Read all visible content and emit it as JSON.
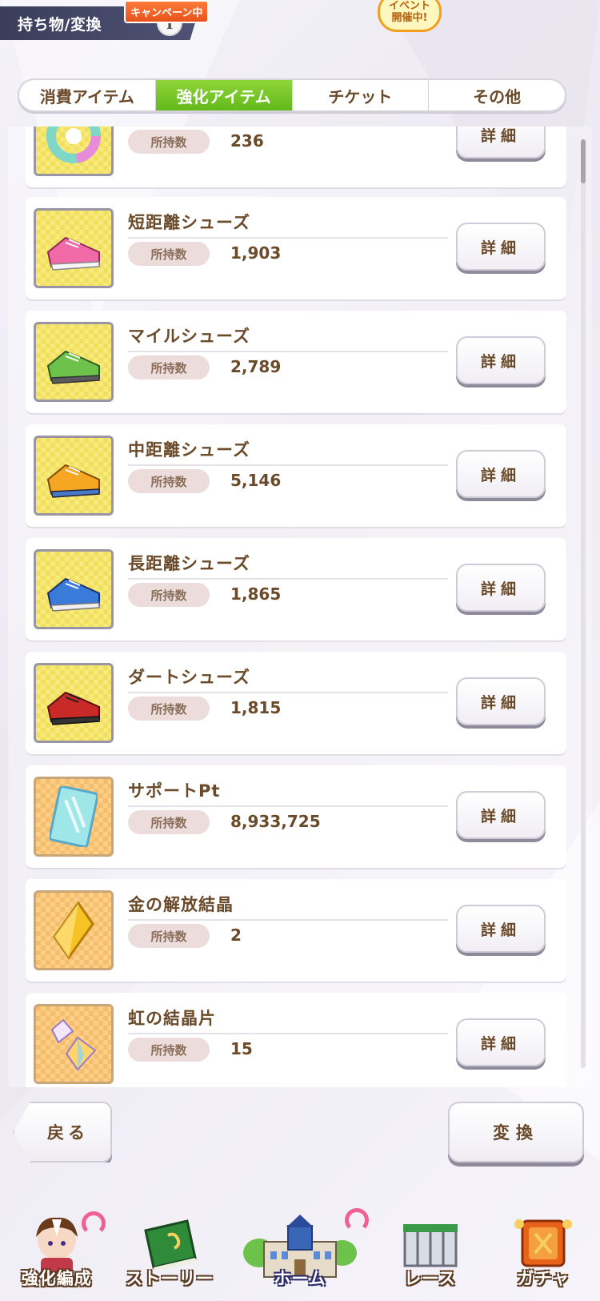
{
  "header": {
    "title": "持ち物/変換",
    "info_icon": "info-icon",
    "info_glyph": "i"
  },
  "tabs": [
    {
      "label": "消費アイテム",
      "active": false
    },
    {
      "label": "強化アイテム",
      "active": true
    },
    {
      "label": "チケット",
      "active": false
    },
    {
      "label": "その他",
      "active": false
    }
  ],
  "items": [
    {
      "name": "",
      "qty_label": "所持数",
      "qty": "236",
      "detail_label": "詳細",
      "icon": "rainbow-disc-icon"
    },
    {
      "name": "短距離シューズ",
      "qty_label": "所持数",
      "qty": "1,903",
      "detail_label": "詳細",
      "icon": "pink-shoes-icon"
    },
    {
      "name": "マイルシューズ",
      "qty_label": "所持数",
      "qty": "2,789",
      "detail_label": "詳細",
      "icon": "green-shoes-icon"
    },
    {
      "name": "中距離シューズ",
      "qty_label": "所持数",
      "qty": "5,146",
      "detail_label": "詳細",
      "icon": "orange-shoes-icon"
    },
    {
      "name": "長距離シューズ",
      "qty_label": "所持数",
      "qty": "1,865",
      "detail_label": "詳細",
      "icon": "blue-shoes-icon"
    },
    {
      "name": "ダートシューズ",
      "qty_label": "所持数",
      "qty": "1,815",
      "detail_label": "詳細",
      "icon": "red-shoes-icon"
    },
    {
      "name": "サポートPt",
      "qty_label": "所持数",
      "qty": "8,933,725",
      "detail_label": "詳細",
      "icon": "support-card-icon"
    },
    {
      "name": "金の解放結晶",
      "qty_label": "所持数",
      "qty": "2",
      "detail_label": "詳細",
      "icon": "gold-crystal-icon"
    },
    {
      "name": "虹の結晶片",
      "qty_label": "所持数",
      "qty": "15",
      "detail_label": "詳細",
      "icon": "rainbow-shard-icon"
    }
  ],
  "actions": {
    "back_label": "戻る",
    "convert_label": "変換"
  },
  "bottom_nav": {
    "items": [
      {
        "label": "強化編成",
        "icon": "character-icon"
      },
      {
        "label": "ストーリー",
        "icon": "book-icon"
      },
      {
        "label": "ホーム",
        "icon": "school-building-icon"
      },
      {
        "label": "レース",
        "icon": "race-gate-icon"
      },
      {
        "label": "ガチャ",
        "icon": "gacha-icon"
      }
    ],
    "campaign_badge": "キャンペーン中",
    "event_badge_line1": "イベント",
    "event_badge_line2": "開催中!"
  },
  "colors": {
    "accent_green": "#62b81a",
    "text_brown": "#6b4a2a",
    "header_navy": "#3a3d5a"
  }
}
